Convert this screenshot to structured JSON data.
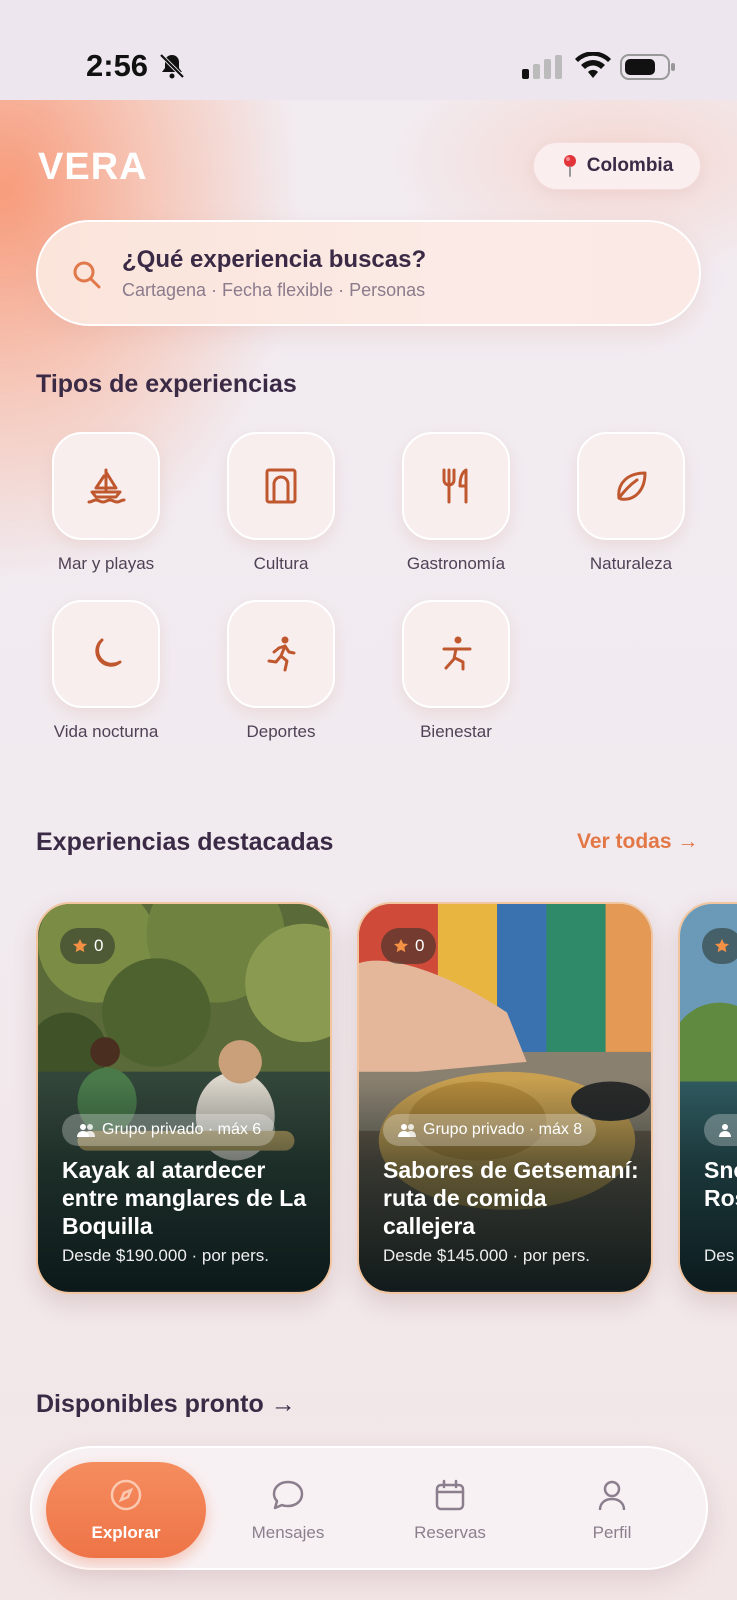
{
  "status": {
    "time": "2:56"
  },
  "header": {
    "logo": "VERA",
    "location": "Colombia"
  },
  "search": {
    "title": "¿Qué experiencia buscas?",
    "subtitle": "Cartagena · Fecha flexible · Personas"
  },
  "categories_section": {
    "title": "Tipos de experiencias",
    "items": [
      {
        "label": "Mar y playas",
        "icon": "sailboat-icon"
      },
      {
        "label": "Cultura",
        "icon": "museum-icon"
      },
      {
        "label": "Gastronomía",
        "icon": "fork-knife-icon"
      },
      {
        "label": "Naturaleza",
        "icon": "leaf-icon"
      },
      {
        "label": "Vida nocturna",
        "icon": "moon-icon"
      },
      {
        "label": "Deportes",
        "icon": "runner-icon"
      },
      {
        "label": "Bienestar",
        "icon": "stretch-icon"
      }
    ]
  },
  "featured": {
    "title": "Experiencias destacadas",
    "see_all": "Ver todas →",
    "cards": [
      {
        "rating": "0",
        "group": "Grupo privado · máx 6",
        "title": "Kayak al atardecer entre manglares de La Boquilla",
        "price": "Desde $190.000 · por pers."
      },
      {
        "rating": "0",
        "group": "Grupo privado · máx 8",
        "title": "Sabores de Getsemaní: ruta de comida callejera",
        "price": "Desde $145.000 · por pers."
      },
      {
        "rating": "",
        "group": "",
        "title": "Snorkel islas del Rosario",
        "price": "Des"
      }
    ]
  },
  "soon": {
    "title": "Disponibles pronto →"
  },
  "tabbar": {
    "tabs": [
      {
        "label": "Explorar",
        "icon": "compass-icon"
      },
      {
        "label": "Mensajes",
        "icon": "chat-icon"
      },
      {
        "label": "Reservas",
        "icon": "calendar-icon"
      },
      {
        "label": "Perfil",
        "icon": "user-icon"
      }
    ]
  },
  "colors": {
    "accent": "#ee7447",
    "icon": "#c0582f",
    "text": "#3a2a45"
  }
}
